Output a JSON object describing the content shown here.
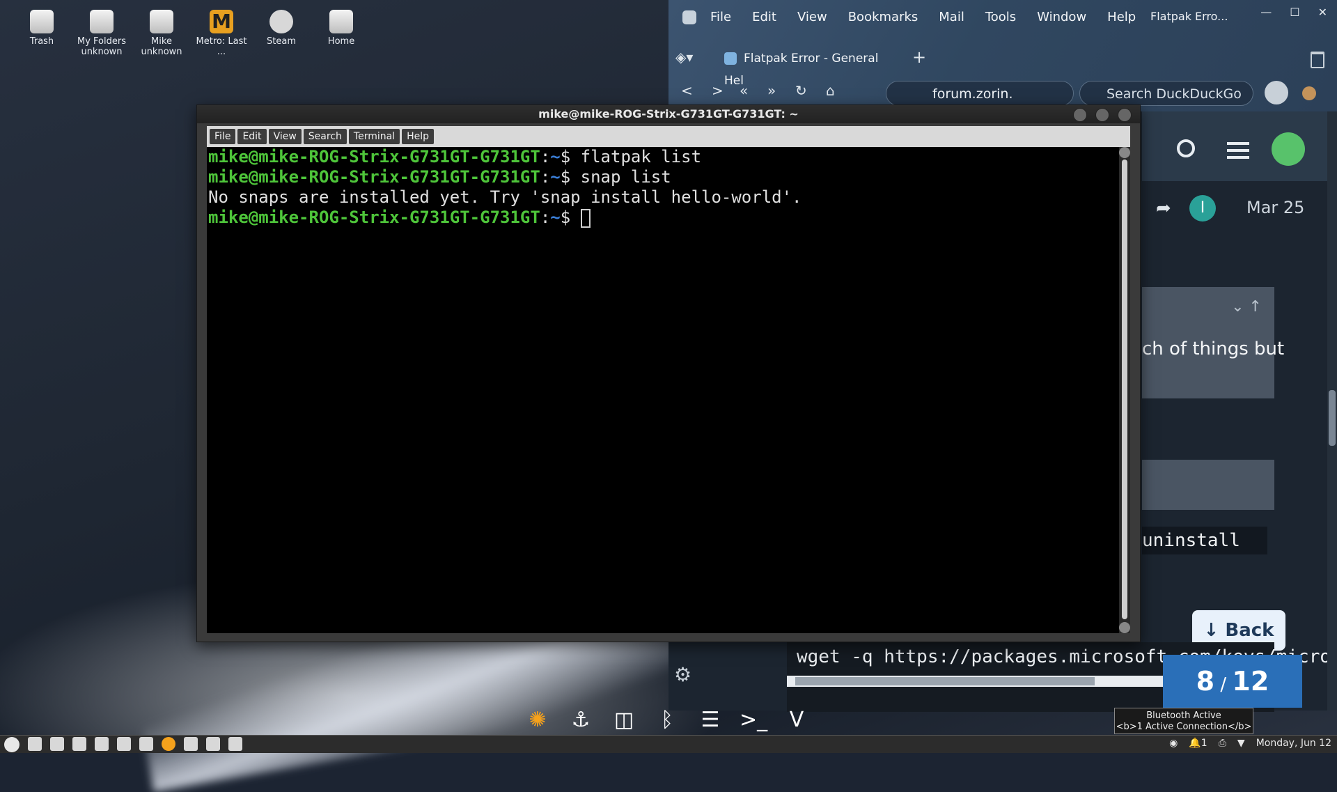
{
  "desktop": {
    "icons": [
      {
        "label": "Trash",
        "sub": ""
      },
      {
        "label": "My Folders",
        "sub": "unknown"
      },
      {
        "label": "Mike",
        "sub": "unknown"
      },
      {
        "label": "Metro: Last ...",
        "sub": ""
      },
      {
        "label": "Steam",
        "sub": ""
      },
      {
        "label": "Home",
        "sub": ""
      }
    ]
  },
  "browser": {
    "menu": [
      "File",
      "Edit",
      "View",
      "Bookmarks",
      "Mail",
      "Tools",
      "Window",
      "Help"
    ],
    "window_title": "Flatpak Erro...",
    "tab_title": "Flatpak Error - General Hel",
    "url": "forum.zorin.",
    "search_placeholder": "Search DuckDuckGo"
  },
  "forum": {
    "date": "Mar 25",
    "initial": "I",
    "quote_text": "ch of things but",
    "code_snippet": "uninstall",
    "back_label": "Back",
    "wget_line": "wget -q https://packages.microsoft.com/keys/micro",
    "pager_current": "8",
    "pager_total": "12"
  },
  "terminal": {
    "title": "mike@mike-ROG-Strix-G731GT-G731GT: ~",
    "menu": [
      "File",
      "Edit",
      "View",
      "Search",
      "Terminal",
      "Help"
    ],
    "prompt_user": "mike@mike-ROG-Strix-G731GT-G731GT",
    "prompt_sep": ":",
    "prompt_path": "~",
    "prompt_sym": "$ ",
    "lines": [
      {
        "type": "cmd",
        "text": "flatpak list"
      },
      {
        "type": "cmd",
        "text": "snap list"
      },
      {
        "type": "out",
        "text": "No snaps are installed yet. Try 'snap install hello-world'."
      },
      {
        "type": "cmd",
        "text": ""
      }
    ]
  },
  "tooltip": {
    "line1": "Bluetooth Active",
    "line2": "<b>1 Active Connection</b>"
  },
  "taskbar": {
    "notif": "1",
    "clock": "Monday, Jun 12"
  }
}
